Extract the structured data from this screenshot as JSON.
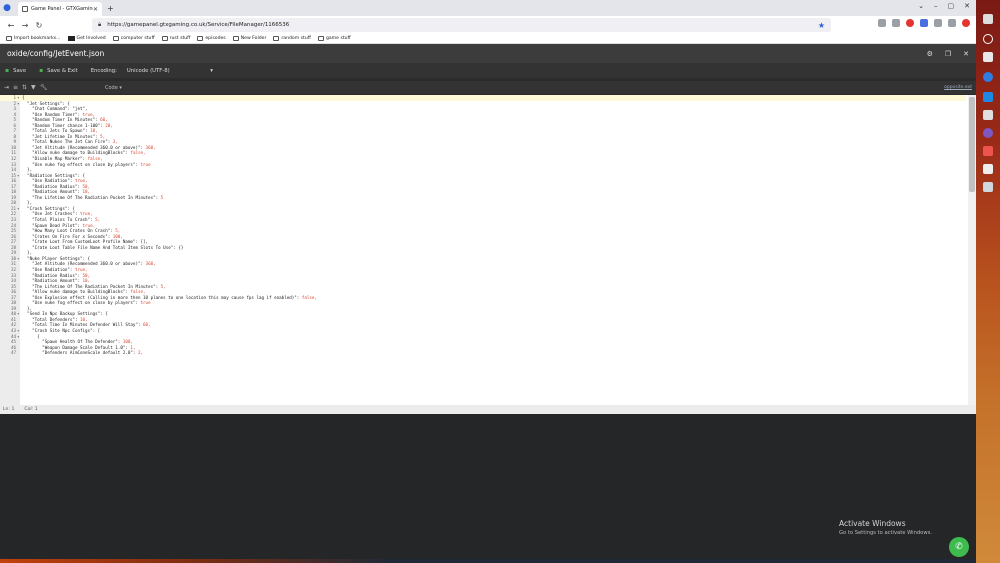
{
  "browser": {
    "tab_title": "Game Panel - GTXGaming.co...",
    "url": "https://gamepanel.gtxgaming.co.uk/Service/FileManager/1166536",
    "bookmarks": [
      "Import bookmarks...",
      "Get Involved",
      "computer stuff",
      "rust stuff",
      "episodes",
      "New Folder",
      "random stuff",
      "game stuff"
    ]
  },
  "panel": {
    "file_title": "oxide/config/JetEvent.json"
  },
  "toolbar": {
    "save_label": "Save",
    "save_exit_label": "Save & Exit",
    "encoding_label": "Encoding:",
    "encoding_value": "Unicode (UTF-8)"
  },
  "subbar": {
    "mode_label": "Code",
    "right_link": "opposite.ext"
  },
  "editor": {
    "lines": [
      "{",
      "  \"Jet Settings\": {",
      "    \"Chat Command\": \"jet\",",
      "    \"Use Random Timer\": true,",
      "    \"Random Timer In Minutes\": 60,",
      "    \"Random Timer chance 1-100\": 20,",
      "    \"Total Jets To Spawn\": 10,",
      "    \"Jet Lifetime In Minutes\": 5,",
      "    \"Total Nukes The Jet Can Fire\": 3,",
      "    \"Jet Altitude (Recommended 360.0 or above)\": 360,",
      "    \"Allow nuke damage to BuildingBlocks\": false,",
      "    \"Disable Map Marker\": false,",
      "    \"Use nuke fog effect on close by players\": true",
      "  },",
      "  \"Radiation Settings\": {",
      "    \"Use Radiation\": true,",
      "    \"Radiation Radius\": 50,",
      "    \"Radiation Amount\": 10,",
      "    \"The Lifetime Of The Radiation Pocket In Minutes\": 5",
      "  },",
      "  \"Crash Settings\": {",
      "    \"Use Jet Crashes\": true,",
      "    \"Total Plains To Crash\": 5,",
      "    \"Spawn Dead Pilot\": true,",
      "    \"How Many Loot Crates On Crash\": 5,",
      "    \"Crates On Fire For x Seconds\": 100,",
      "    \"Crate Loot From CustomLoot Profile Name\": [],",
      "    \"Crate Loot Table File Name And Total Item Slots To Use\": {}",
      "  },",
      "  \"Nuke Player Settings\": {",
      "    \"Jet Altitude (Recommended 360.0 or above)\": 360,",
      "    \"Use Radiation\": true,",
      "    \"Radiation Radius\": 50,",
      "    \"Radiation Amount\": 10,",
      "    \"The Lifetime Of The Radiation Pocket In Minutes\": 5,",
      "    \"Allow nuke damage to BuildingBlocks\": false,",
      "    \"Use Explosion effect (Calling in more then 10 planes to one location this may cause fps lag if enabled)\": false,",
      "    \"Use nuke fog effect on close by players\": true",
      "  },",
      "  \"Send In Npc Backup Settings\": {",
      "    \"Total Defenders\": 10,",
      "    \"Total Time In Minutes Defender Will Stay\": 60,",
      "    \"Crash Site Npc Configs\": [",
      "      {",
      "        \"Spawn Health Of The Defender\": 100,",
      "        \"Weapon Damage Scale Default 1.0\": 1,",
      "        \"Defenders AimConeScale default 2.0\": 2,"
    ]
  },
  "status": {
    "line": "Ln: 1",
    "col": "Col: 1"
  },
  "desktop": {
    "activate_title": "Activate Windows",
    "activate_sub": "Go to Settings to activate Windows."
  }
}
